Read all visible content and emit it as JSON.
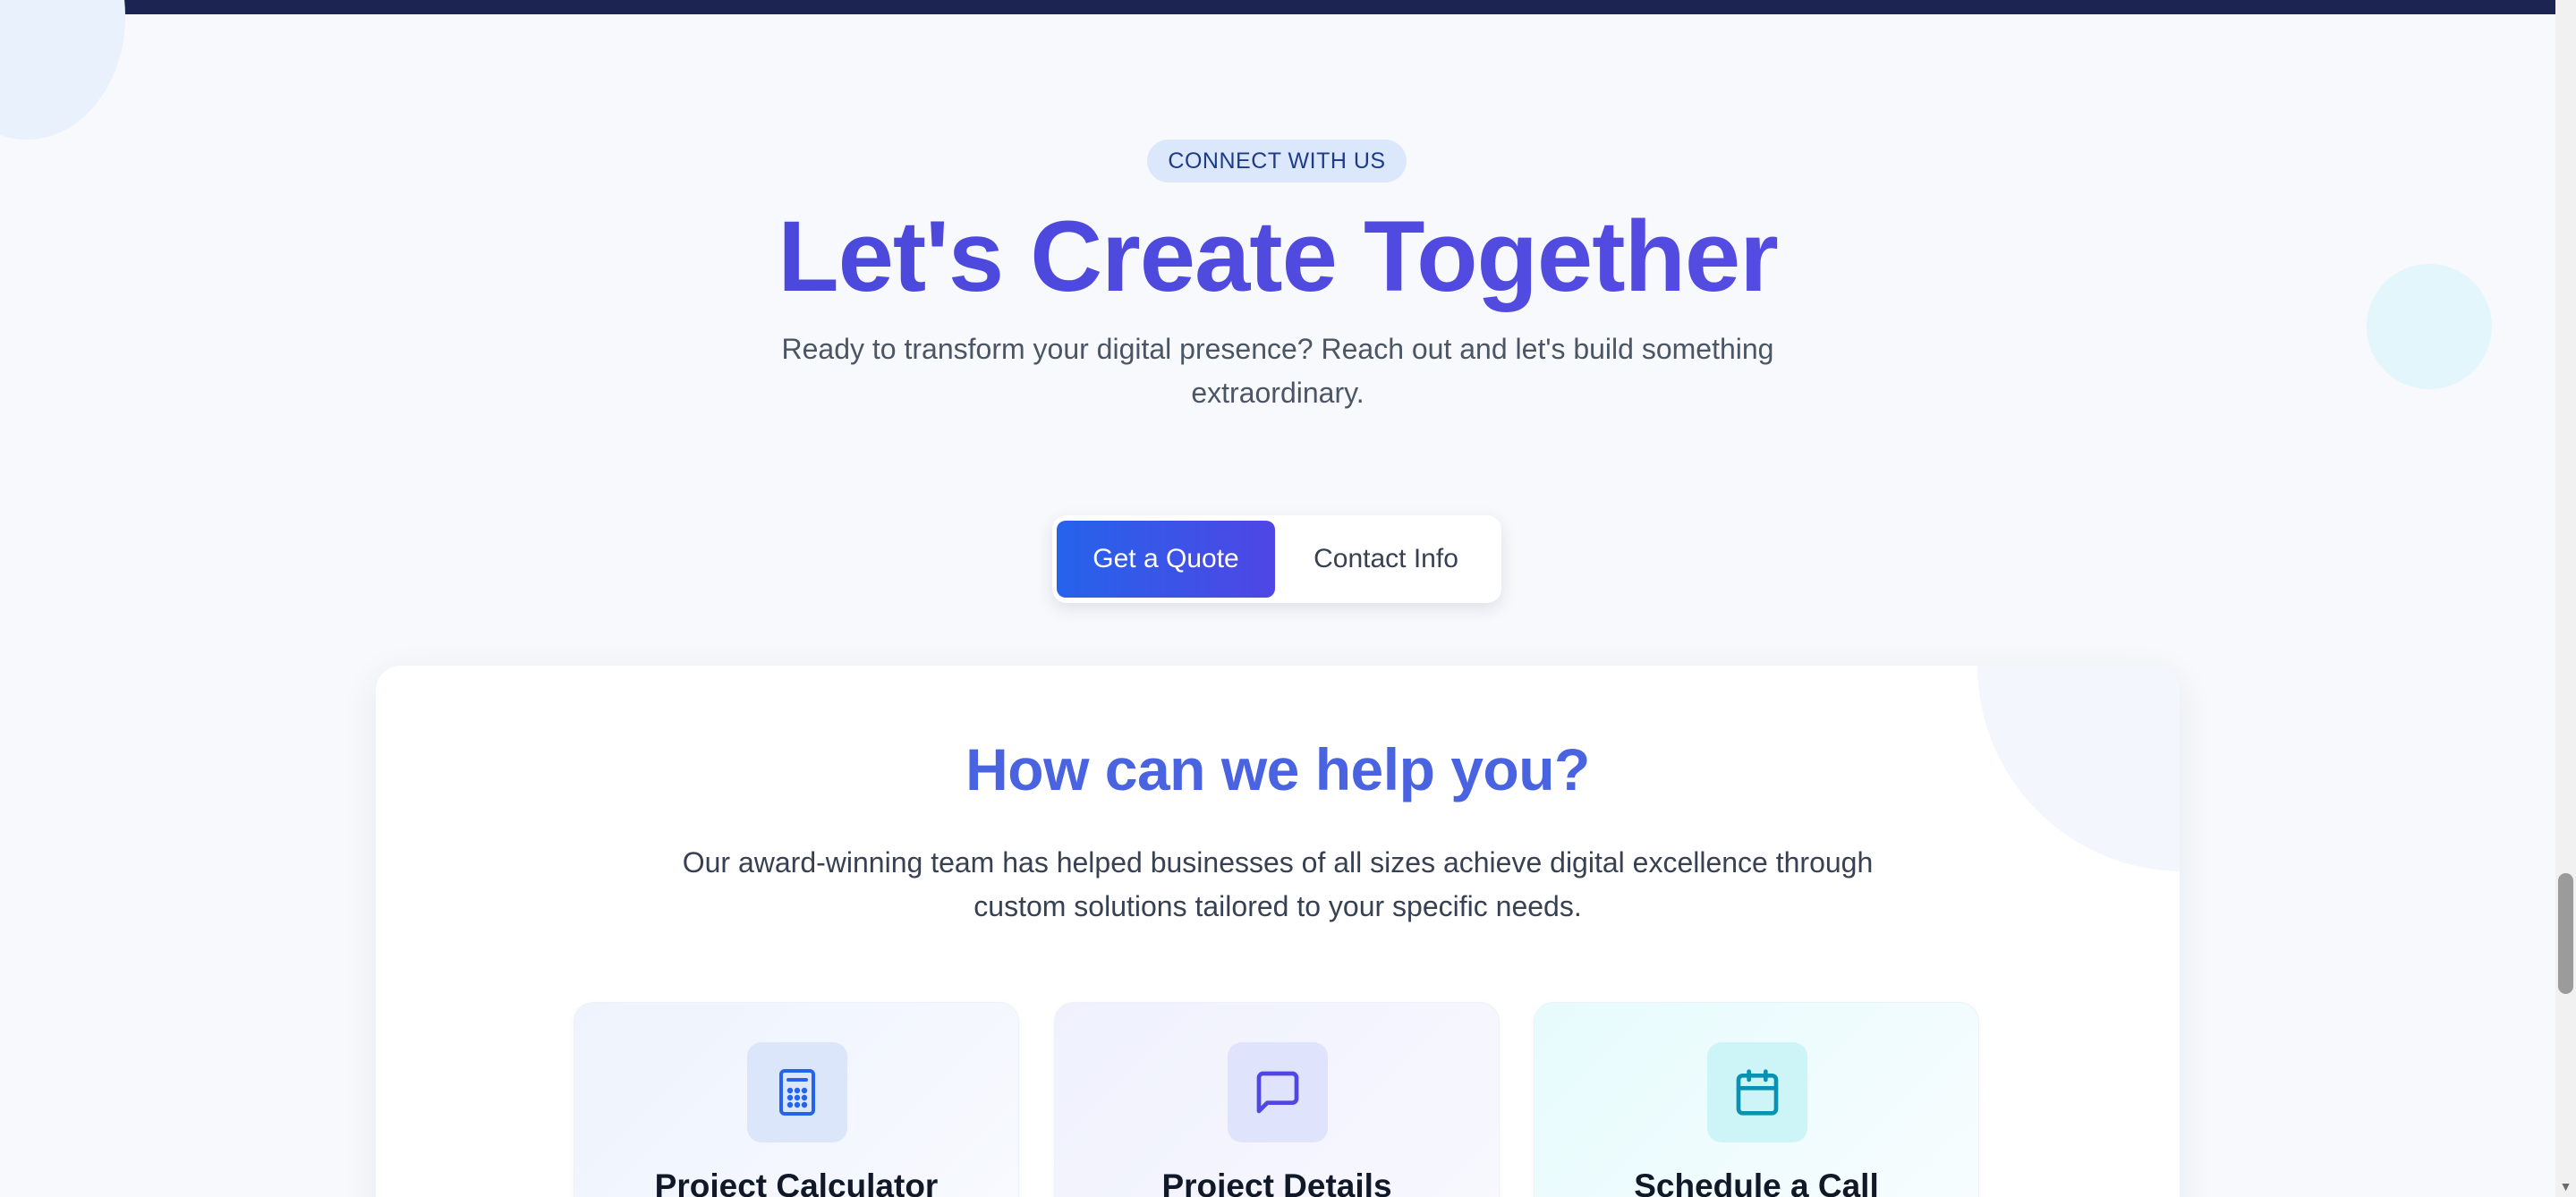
{
  "hero": {
    "badge": "CONNECT WITH US",
    "title": "Let's Create Together",
    "subtitle": "Ready to transform your digital presence? Reach out and let's build something extraordinary.",
    "buttons": {
      "quote": "Get a Quote",
      "contact": "Contact Info"
    }
  },
  "help": {
    "title": "How can we help you?",
    "subtitle": "Our award-winning team has helped businesses of all sizes achieve digital excellence through custom solutions tailored to your specific needs.",
    "options": [
      {
        "title": "Project Calculator",
        "icon": "calculator-icon",
        "color": "#2563eb"
      },
      {
        "title": "Project Details",
        "icon": "message-square-icon",
        "color": "#4f46e5"
      },
      {
        "title": "Schedule a Call",
        "icon": "calendar-icon",
        "color": "#0891b2"
      }
    ]
  },
  "colors": {
    "accent": "#4f46e5",
    "primary": "#2563eb",
    "nav_bar": "#1c2451"
  }
}
